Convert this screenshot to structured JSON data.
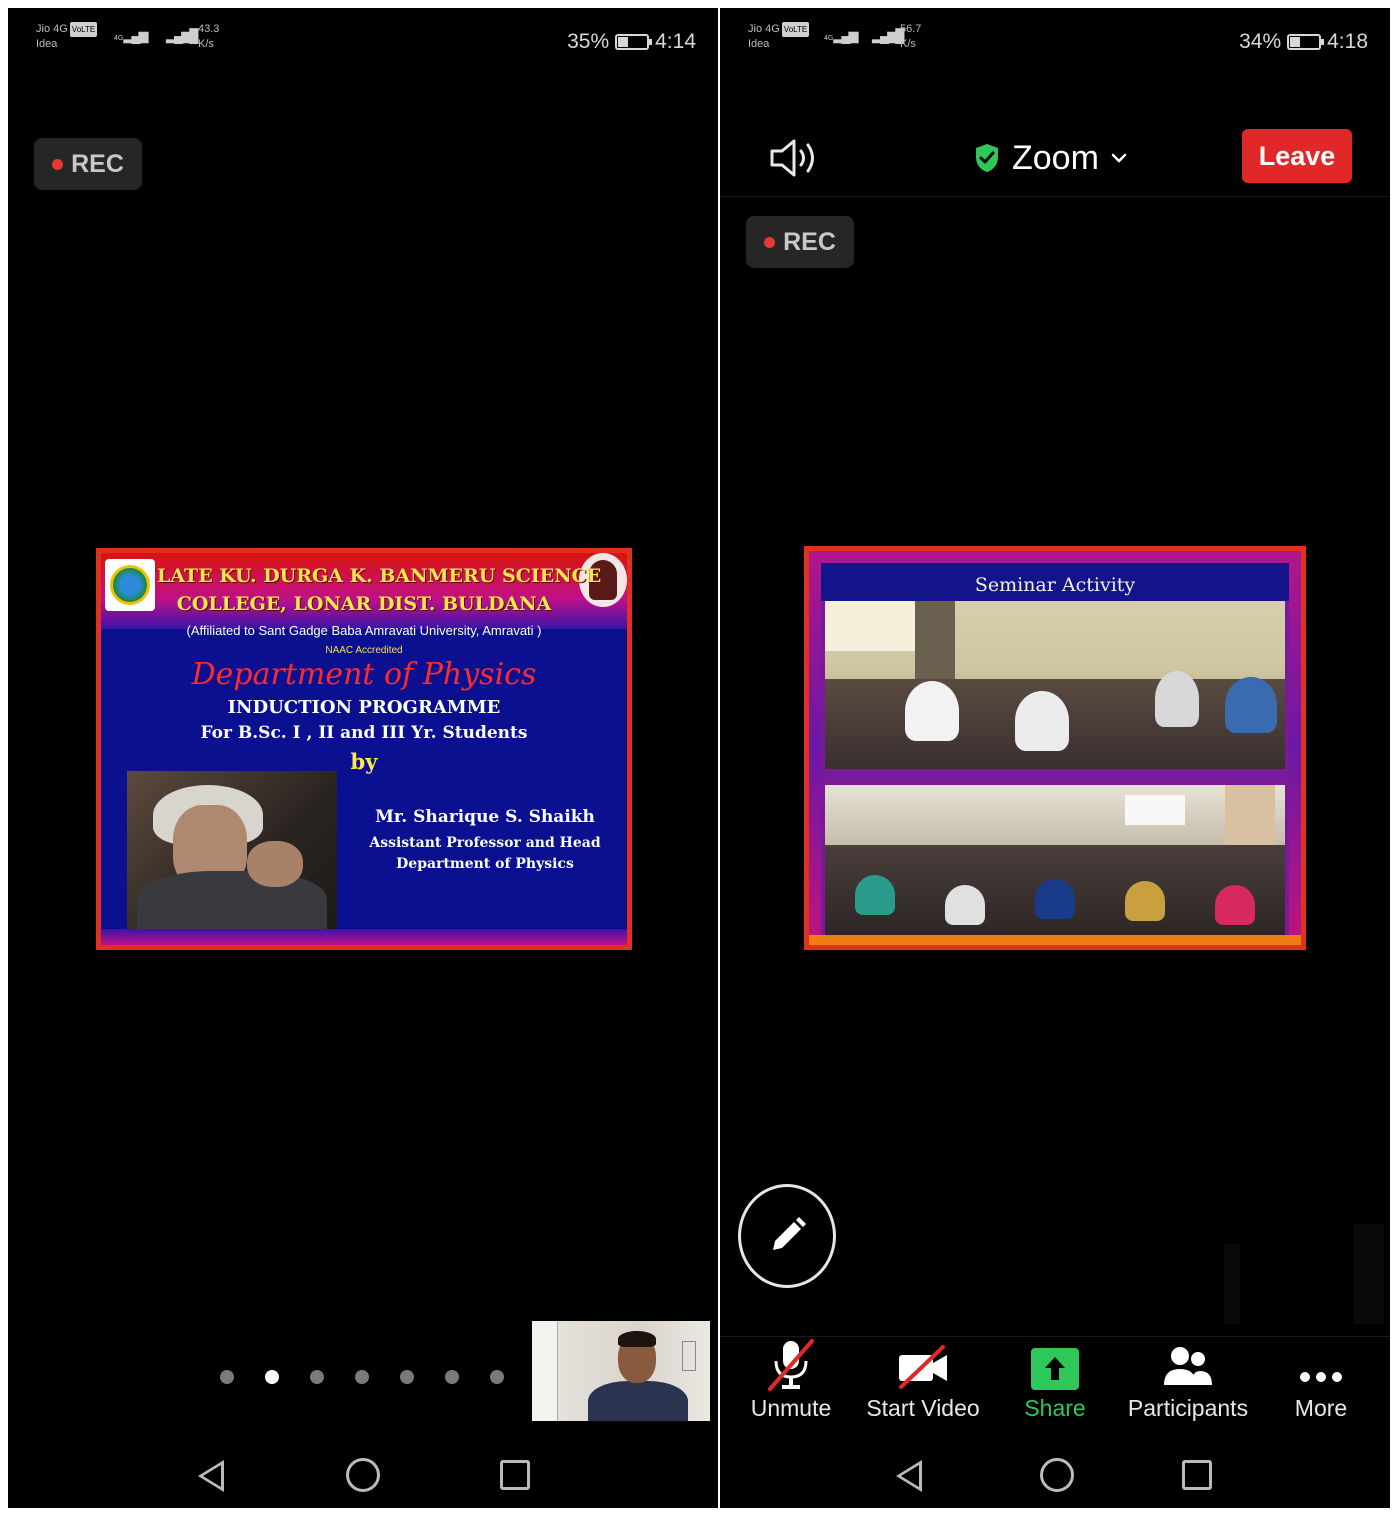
{
  "left": {
    "status": {
      "carrier1": "Jio 4G",
      "volte": "VoLTE",
      "carrier2": "Idea",
      "net": "4G",
      "speed_value": "43.3",
      "speed_unit": "K/s",
      "battery": "35%",
      "battery_level": 0.35,
      "time": "4:14"
    },
    "rec_label": "REC",
    "slide": {
      "college_line1": "LATE KU. DURGA K. BANMERU SCIENCE",
      "college_line2": "COLLEGE, LONAR DIST. BULDANA",
      "affiliation": "(Affiliated to Sant Gadge Baba Amravati University, Amravati )",
      "naac": "NAAC Accredited",
      "department": "Department of Physics",
      "programme": "INDUCTION PROGRAMME",
      "students": "For  B.Sc. I , II and III Yr. Students",
      "by": "by",
      "presenter": "Mr.  Sharique S. Shaikh",
      "role": "Assistant Professor  and Head",
      "presenter_dept": "Department of Physics"
    },
    "pager": {
      "count": 7,
      "active_index": 1
    }
  },
  "right": {
    "status": {
      "carrier1": "Jio 4G",
      "volte": "VoLTE",
      "carrier2": "Idea",
      "net": "4G",
      "speed_value": "56.7",
      "speed_unit": "K/s",
      "battery": "34%",
      "battery_level": 0.34,
      "time": "4:18"
    },
    "meeting_title": "Zoom",
    "leave_label": "Leave",
    "rec_label": "REC",
    "slide": {
      "title": "Seminar Activity"
    },
    "toolbar": {
      "unmute": "Unmute",
      "start_video": "Start Video",
      "share": "Share",
      "participants": "Participants",
      "more": "More"
    }
  },
  "colors": {
    "leave_red": "#e02828",
    "share_green": "#2ec85a",
    "rec_dot": "#e53935",
    "shield_green": "#2ec85a"
  },
  "icons": [
    "speaker-icon",
    "shield-check-icon",
    "chevron-down-icon",
    "pencil-icon",
    "microphone-muted-icon",
    "video-off-icon",
    "share-arrow-icon",
    "participants-icon",
    "more-dots-icon",
    "nav-back-icon",
    "nav-home-icon",
    "nav-recents-icon"
  ]
}
